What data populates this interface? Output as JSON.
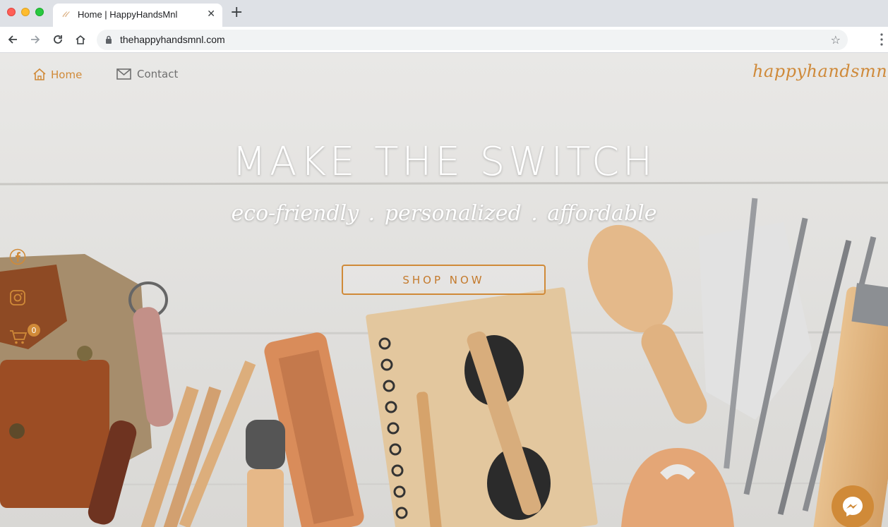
{
  "browser": {
    "tab_title": "Home | HappyHandsMnl",
    "tab_favicon": "𝓁𝓁",
    "url": "thehappyhandsmnl.com"
  },
  "nav": {
    "home_label": "Home",
    "contact_label": "Contact"
  },
  "brand": "happyhandsmnl",
  "hero": {
    "headline": "MAKE THE SWITCH",
    "tagline": "eco-friendly . personalized . affordable",
    "cta_label": "SHOP NOW"
  },
  "cart": {
    "count": "0"
  },
  "colors": {
    "accent": "#d08a38",
    "nav_text": "#6f6f6f",
    "headline": "#ffffff"
  },
  "icons": [
    "home-icon",
    "mail-icon",
    "facebook-icon",
    "instagram-icon",
    "cart-icon",
    "messenger-icon"
  ]
}
